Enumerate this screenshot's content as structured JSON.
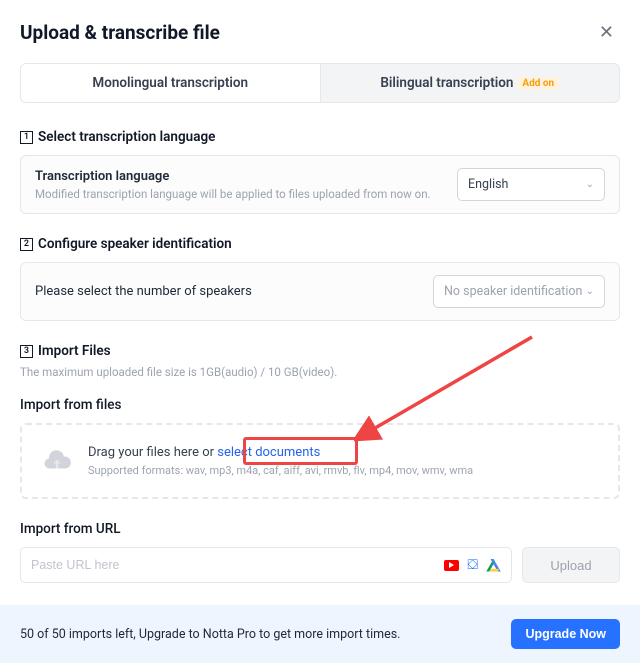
{
  "header": {
    "title": "Upload & transcribe file"
  },
  "tabs": {
    "mono": "Monolingual transcription",
    "bi": "Bilingual transcription",
    "addon": "Add on"
  },
  "step1": {
    "num": "1",
    "heading": "Select transcription language",
    "label": "Transcription language",
    "sub": "Modified transcription language will be applied to files uploaded from now on.",
    "value": "English"
  },
  "step2": {
    "num": "2",
    "heading": "Configure speaker identification",
    "prompt": "Please select the number of speakers",
    "placeholder": "No speaker identification"
  },
  "step3": {
    "num": "3",
    "heading": "Import Files",
    "note": "The maximum uploaded file size is 1GB(audio) / 10 GB(video).",
    "from_files_label": "Import from files",
    "dz_prefix": "Drag your files here or ",
    "dz_link": "select documents",
    "dz_formats": "Supported formats: wav, mp3, m4a, caf, aiff, avi, rmvb, flv, mp4, mov, wmv, wma",
    "from_url_label": "Import from URL",
    "url_placeholder": "Paste URL here",
    "upload_btn": "Upload"
  },
  "footer": {
    "text": "50 of 50 imports left, Upgrade to Notta Pro to get more import times.",
    "btn": "Upgrade Now"
  }
}
